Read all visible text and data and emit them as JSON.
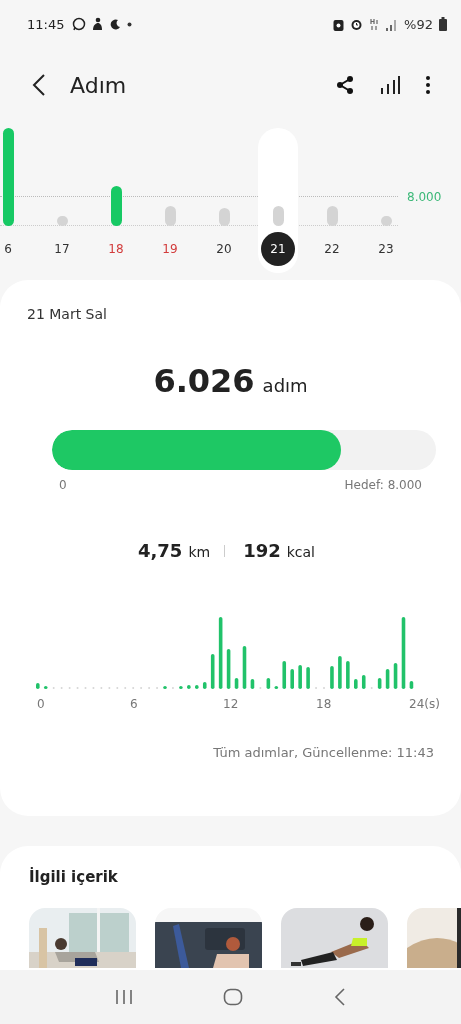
{
  "status_bar": {
    "time": "11:45",
    "battery": "%92"
  },
  "header": {
    "title": "Adım"
  },
  "week_chart": {
    "goal_label": "8.000",
    "days": [
      {
        "label": "6",
        "goal_met": true,
        "weekend": false,
        "selected": false
      },
      {
        "label": "17",
        "goal_met": false,
        "weekend": false,
        "selected": false
      },
      {
        "label": "18",
        "goal_met": true,
        "weekend": true,
        "selected": false
      },
      {
        "label": "19",
        "goal_met": false,
        "weekend": true,
        "selected": false
      },
      {
        "label": "20",
        "goal_met": false,
        "weekend": false,
        "selected": false
      },
      {
        "label": "21",
        "goal_met": false,
        "weekend": false,
        "selected": true
      },
      {
        "label": "22",
        "goal_met": false,
        "weekend": false,
        "selected": false
      },
      {
        "label": "23",
        "goal_met": false,
        "weekend": false,
        "selected": false
      }
    ]
  },
  "summary": {
    "date": "21 Mart Sal",
    "steps": "6.026",
    "unit": "adım",
    "progress": {
      "level": 0.753,
      "start_label": "0",
      "goal_label": "Hedef: 8.000"
    },
    "distance": "4,75",
    "distance_unit": "km",
    "calories": "192",
    "calories_unit": "kcal",
    "hourly_axis": [
      "0",
      "6",
      "12",
      "18",
      "24(s)"
    ],
    "footer": "Tüm adımlar, Güncellenme: 11:43"
  },
  "related": {
    "title": "İlgili içerik"
  }
}
